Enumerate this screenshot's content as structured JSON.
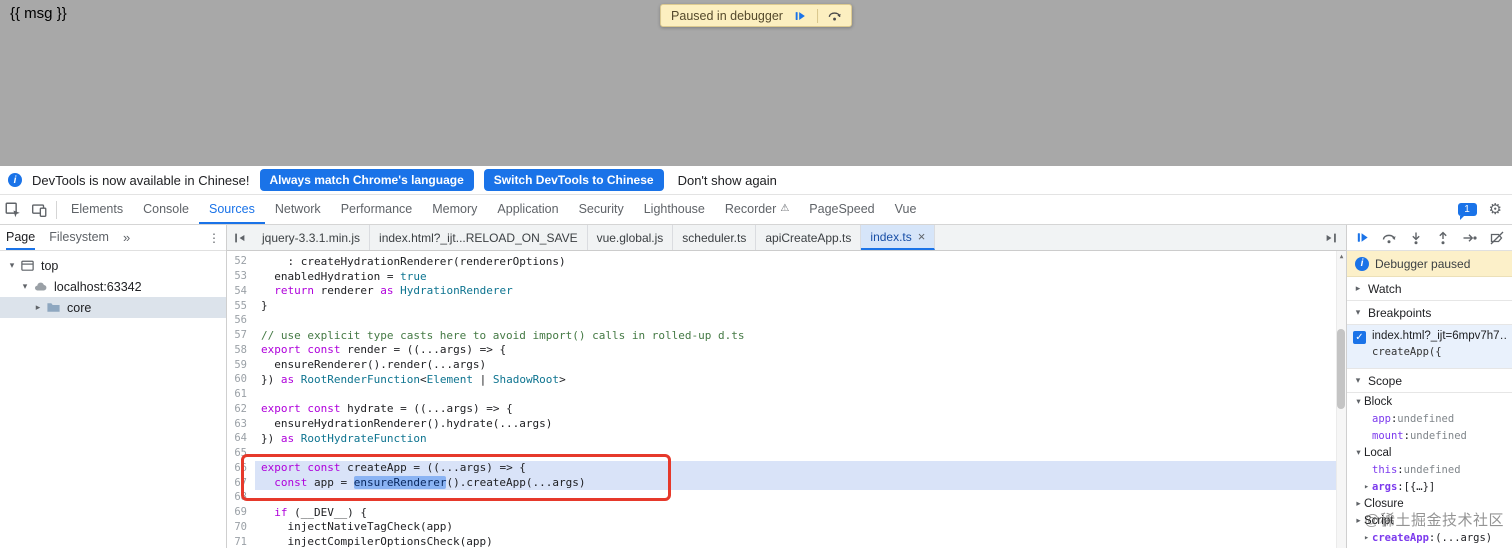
{
  "colors": {
    "accent": "#1a73e8",
    "red_box": "#e6392b",
    "page_dim": "#a8a8a8",
    "paused_bg": "#fcf0c9",
    "hl_line": "#d9e3f8",
    "token_bg": "#8ab3f3",
    "keyword": "#af00db",
    "type_name": "#0e7490",
    "comment": "#457a45",
    "atom": "#0e7490",
    "prop_name": "#7c3aed",
    "value_muted": "#80868b"
  },
  "icons": {
    "info": "i",
    "close": "×",
    "more_tabs": "»",
    "menu": "⋮",
    "gear": "⚙",
    "warn": "⚠",
    "check": "✓",
    "scroll_up": "▲"
  },
  "page": {
    "msg": "{{ msg }}",
    "paused_banner": {
      "label": "Paused in debugger"
    }
  },
  "notice": {
    "text": "DevTools is now available in Chinese!",
    "match_button": "Always match Chrome's language",
    "switch_button": "Switch DevTools to Chinese",
    "dismiss": "Don't show again"
  },
  "toolbar": {
    "issues_count": "1",
    "tabs": [
      {
        "label": "Elements"
      },
      {
        "label": "Console"
      },
      {
        "label": "Sources",
        "active": true
      },
      {
        "label": "Network"
      },
      {
        "label": "Performance"
      },
      {
        "label": "Memory"
      },
      {
        "label": "Application"
      },
      {
        "label": "Security"
      },
      {
        "label": "Lighthouse"
      },
      {
        "label": "Recorder",
        "warn": true
      },
      {
        "label": "PageSpeed"
      },
      {
        "label": "Vue"
      }
    ]
  },
  "navigator": {
    "tabs": [
      {
        "label": "Page",
        "active": true
      },
      {
        "label": "Filesystem",
        "active": false
      }
    ],
    "tree": [
      {
        "label": "top",
        "icon": "frame",
        "caret": "▾",
        "depth": 0,
        "selected": false
      },
      {
        "label": "localhost:63342",
        "icon": "cloud",
        "caret": "▾",
        "depth": 1,
        "selected": false
      },
      {
        "label": "core",
        "icon": "folder",
        "caret": "▸",
        "depth": 2,
        "selected": true
      }
    ]
  },
  "editor": {
    "tabs": [
      {
        "label": "jquery-3.3.1.min.js"
      },
      {
        "label": "index.html?_ijt...RELOAD_ON_SAVE"
      },
      {
        "label": "vue.global.js"
      },
      {
        "label": "scheduler.ts"
      },
      {
        "label": "apiCreateApp.ts"
      },
      {
        "label": "index.ts",
        "active": true
      }
    ],
    "lines": [
      {
        "n": 52,
        "segs": [
          [
            "    : createHydrationRenderer(rendererOptions)",
            "p"
          ]
        ]
      },
      {
        "n": 53,
        "segs": [
          [
            "  enabledHydration = ",
            "p"
          ],
          [
            "true",
            "n"
          ]
        ]
      },
      {
        "n": 54,
        "segs": [
          [
            "  ",
            "p"
          ],
          [
            "return",
            "k"
          ],
          [
            " renderer ",
            "p"
          ],
          [
            "as",
            "k"
          ],
          [
            " ",
            "p"
          ],
          [
            "HydrationRenderer",
            "t"
          ]
        ]
      },
      {
        "n": 55,
        "segs": [
          [
            "}",
            "p"
          ]
        ]
      },
      {
        "n": 56,
        "segs": []
      },
      {
        "n": 57,
        "segs": [
          [
            "// use explicit type casts here to avoid import() calls in rolled-up d.ts",
            "c"
          ]
        ]
      },
      {
        "n": 58,
        "segs": [
          [
            "export",
            "k"
          ],
          [
            " ",
            "p"
          ],
          [
            "const",
            "k"
          ],
          [
            " render = ((...args) => {",
            "p"
          ]
        ]
      },
      {
        "n": 59,
        "segs": [
          [
            "  ensureRenderer().render(...args)",
            "p"
          ]
        ]
      },
      {
        "n": 60,
        "segs": [
          [
            "}) ",
            "p"
          ],
          [
            "as",
            "k"
          ],
          [
            " ",
            "p"
          ],
          [
            "RootRenderFunction",
            "t"
          ],
          [
            "<",
            "p"
          ],
          [
            "Element",
            "t"
          ],
          [
            " | ",
            "p"
          ],
          [
            "ShadowRoot",
            "t"
          ],
          [
            ">",
            "p"
          ]
        ]
      },
      {
        "n": 61,
        "segs": []
      },
      {
        "n": 62,
        "segs": [
          [
            "export",
            "k"
          ],
          [
            " ",
            "p"
          ],
          [
            "const",
            "k"
          ],
          [
            " hydrate = ((...args) => {",
            "p"
          ]
        ]
      },
      {
        "n": 63,
        "segs": [
          [
            "  ensureHydrationRenderer().hydrate(...args)",
            "p"
          ]
        ]
      },
      {
        "n": 64,
        "segs": [
          [
            "}) ",
            "p"
          ],
          [
            "as",
            "k"
          ],
          [
            " ",
            "p"
          ],
          [
            "RootHydrateFunction",
            "t"
          ]
        ]
      },
      {
        "n": 65,
        "segs": []
      },
      {
        "n": 66,
        "hl": true,
        "segs": [
          [
            "export",
            "k"
          ],
          [
            " ",
            "p"
          ],
          [
            "const",
            "k"
          ],
          [
            " createApp = ((...args) => {",
            "p"
          ]
        ]
      },
      {
        "n": 67,
        "hl": true,
        "segs": [
          [
            "  ",
            "p"
          ],
          [
            "const",
            "k"
          ],
          [
            " app = ",
            "p"
          ],
          [
            "ensureRenderer",
            "sel"
          ],
          [
            "().createApp(...args)",
            "p"
          ]
        ]
      },
      {
        "n": 68,
        "segs": []
      },
      {
        "n": 69,
        "segs": [
          [
            "  ",
            "p"
          ],
          [
            "if",
            "k"
          ],
          [
            " (__DEV__) {",
            "p"
          ]
        ]
      },
      {
        "n": 70,
        "segs": [
          [
            "    injectNativeTagCheck(app)",
            "p"
          ]
        ]
      },
      {
        "n": 71,
        "segs": [
          [
            "    injectCompilerOptionsCheck(app)",
            "p"
          ]
        ]
      }
    ]
  },
  "sidebar": {
    "paused_label": "Debugger paused",
    "watch_caret": "▸",
    "watch_label": "Watch",
    "breakpoints_caret": "▾",
    "breakpoints_label": "Breakpoints",
    "breakpoint": {
      "checked": true,
      "file": "index.html?_ijt=6mpv7h7…",
      "snippet": "createApp({"
    },
    "scope_caret": "▾",
    "scope_label": "Scope",
    "scope": [
      {
        "caret": "▾",
        "label": "Block"
      },
      {
        "caret": "",
        "name": "app",
        "value": "undefined",
        "vclass": "muted"
      },
      {
        "caret": "",
        "name": "mount",
        "value": "undefined",
        "vclass": "muted"
      },
      {
        "caret": "▾",
        "label": "Local"
      },
      {
        "caret": "",
        "name": "this",
        "value": "undefined",
        "vclass": "muted"
      },
      {
        "caret": "▸",
        "name": "args",
        "value": "[{…}]",
        "bold": true
      },
      {
        "caret": "▸",
        "label": "Closure"
      },
      {
        "caret": "▸",
        "label": "Script"
      },
      {
        "caret": "▸",
        "name": "createApp",
        "value": "(...args)",
        "bold": true
      }
    ]
  },
  "watermark": {
    "text": "@稀土掘金技术社区"
  }
}
